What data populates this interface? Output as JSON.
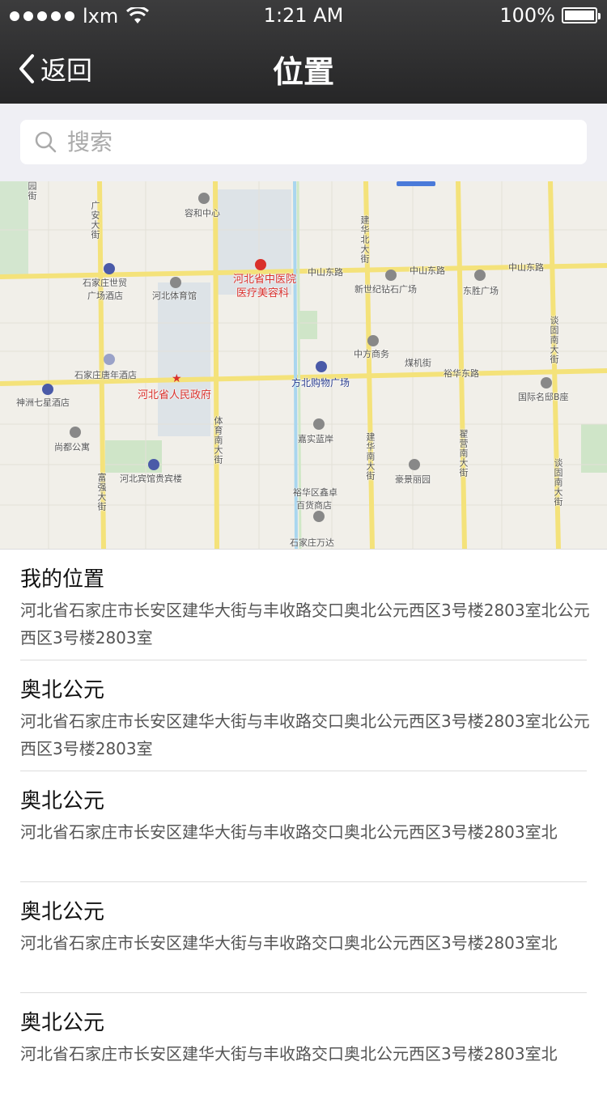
{
  "status_bar": {
    "carrier": "lxm",
    "time": "1:21 AM",
    "battery": "100%",
    "battery_level": 1.0
  },
  "nav": {
    "back_label": "返回",
    "title": "位置"
  },
  "search": {
    "placeholder": "搜索"
  },
  "map": {
    "labels": {
      "rongjiang": "容和中心",
      "hebei_hospital": "河北省中医院",
      "hospital_sub": "医疗美容科",
      "zhongshan_e1": "中山东路",
      "zhongshan_e2": "中山东路",
      "zhongshan_e3": "中山东路",
      "shimao": "石家庄世贸",
      "shimao_sub": "广场酒店",
      "gym": "河北体育馆",
      "xinshiji": "新世纪钻石广场",
      "dongsheng": "东胜广场",
      "zhongfang": "中方商务",
      "meiji": "煤机街",
      "yuhua_e": "裕华东路",
      "tangnian": "石家庄唐年酒店",
      "gov": "河北省人民政府",
      "fangbei": "方北购物广场",
      "qixing": "神洲七星酒店",
      "mingdu": "国际名邸B座",
      "shangdu": "尚都公寓",
      "jiashi": "嘉实蓝岸",
      "guesthouse": "河北宾馆贵宾楼",
      "haojing": "豪景丽园",
      "yuhua_store": "裕华区鑫卓",
      "yuhua_store_sub": "百货商店",
      "wanda": "石家庄万达",
      "guang_an": "广安大街",
      "jianhua_n": "建华北大街",
      "tancheng": "谈固南大街",
      "tiyu_s": "体育南大街",
      "jianhua_s": "建华南大街",
      "zhaiying": "翟营南大街",
      "tancheng_s": "谈固南大街",
      "fuqiang": "富强大街",
      "yuanjie": "园街"
    }
  },
  "results": [
    {
      "title": "我的位置",
      "address": "河北省石家庄市长安区建华大街与丰收路交口奥北公元西区3号楼2803室北公元西区3号楼2803室"
    },
    {
      "title": "奥北公元",
      "address": "河北省石家庄市长安区建华大街与丰收路交口奥北公元西区3号楼2803室北公元西区3号楼2803室"
    },
    {
      "title": "奥北公元",
      "address": "河北省石家庄市长安区建华大街与丰收路交口奥北公元西区3号楼2803室北"
    },
    {
      "title": "奥北公元",
      "address": "河北省石家庄市长安区建华大街与丰收路交口奥北公元西区3号楼2803室北"
    },
    {
      "title": "奥北公元",
      "address": "河北省石家庄市长安区建华大街与丰收路交口奥北公元西区3号楼2803室北"
    }
  ]
}
